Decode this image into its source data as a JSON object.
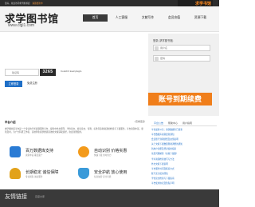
{
  "topbar": {
    "notice": "您好，欢迎访问求学图书馆！",
    "notice_highlight": "资源更新中",
    "promo": "求学书馆"
  },
  "header": {
    "logo_title": "求学图书馆",
    "logo_url": "www.cqjl1.com"
  },
  "nav": {
    "items": [
      {
        "label": "首页"
      },
      {
        "label": "人工客服"
      },
      {
        "label": "文献写作"
      },
      {
        "label": "会员充值"
      },
      {
        "label": "资源下载"
      }
    ]
  },
  "main": {
    "plugin_message": "Couldn't load plugin."
  },
  "login": {
    "title": "登录 (求学图书馆)",
    "username_placeholder": "用户名",
    "password_placeholder": "密码",
    "captcha_placeholder": "验证码",
    "captcha_code": "3265",
    "login_button": "立即登录",
    "register_link": "免费注册",
    "expire_banner": "账号到期续费"
  },
  "intro": {
    "title": "平台介绍",
    "more": "+查看更多",
    "text": "求学图书馆平台是一个专业的学术资源服务平台，提供中外文期刊、学位论文、会议论文、专利、标准等多种资源的检索与下载服务。平台资源丰富，更新及时，为广大科研工作者、高校师生提供便捷高效的文献获取途径，欢迎注册使用。"
  },
  "features": [
    {
      "title": "百万数据库支持",
      "desc": "资源丰富 覆盖面广",
      "icon": "database-icon",
      "color": "#2a7bd4"
    },
    {
      "title": "自动识别 价格实惠",
      "desc": "快速下载 省时省力",
      "icon": "clock-icon",
      "color": "#f39a1b"
    },
    {
      "title": "长期稳定 诚信保障",
      "desc": "专业团队 诚信服务",
      "icon": "user-icon",
      "color": "#e2a21a"
    },
    {
      "title": "安全护航 放心使用",
      "desc": "信息加密 安全可靠",
      "icon": "shield-icon",
      "color": "#3a9ad9"
    }
  ],
  "side": {
    "tabs": [
      "平台公告",
      "帮助中心",
      "用户指南"
    ],
    "items": [
      "平台最新公告：资源数据库已更新",
      "平台数据库资源更新通知",
      "会员账号到期续费及充值说明",
      "关于文献下载数量限制调整的通知",
      "新用户注册及登录使用指南",
      "常见问题解答（文献下载篇）",
      "学术资源检索技巧与方法",
      "外文文献下载说明",
      "平台服务时间及联系方式",
      "账号安全使用须知",
      "学位论文检索与下载指南",
      "平台使用协议及隐私声明"
    ]
  },
  "footer": {
    "title": "友情链接",
    "link": "百度文库"
  }
}
